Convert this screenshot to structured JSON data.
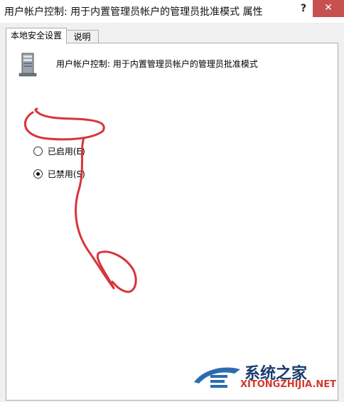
{
  "window": {
    "title": "用户帐户控制: 用于内置管理员帐户的管理员批准模式 属性",
    "help_label": "?",
    "close_label": "✕"
  },
  "tabs": [
    {
      "label": "本地安全设置",
      "active": true
    },
    {
      "label": "说明",
      "active": false
    }
  ],
  "policy": {
    "icon": "server-icon",
    "title": "用户帐户控制: 用于内置管理员帐户的管理员批准模式"
  },
  "options": [
    {
      "label": "已启用(E)",
      "selected": false
    },
    {
      "label": "已禁用(S)",
      "selected": true
    }
  ],
  "annotation": {
    "color": "#d9343a"
  },
  "watermark": {
    "main": "系统之家",
    "sub": "XITONGZHIJIA.NET",
    "color_main": "#1a3c6e",
    "color_sub": "#d1392e"
  }
}
